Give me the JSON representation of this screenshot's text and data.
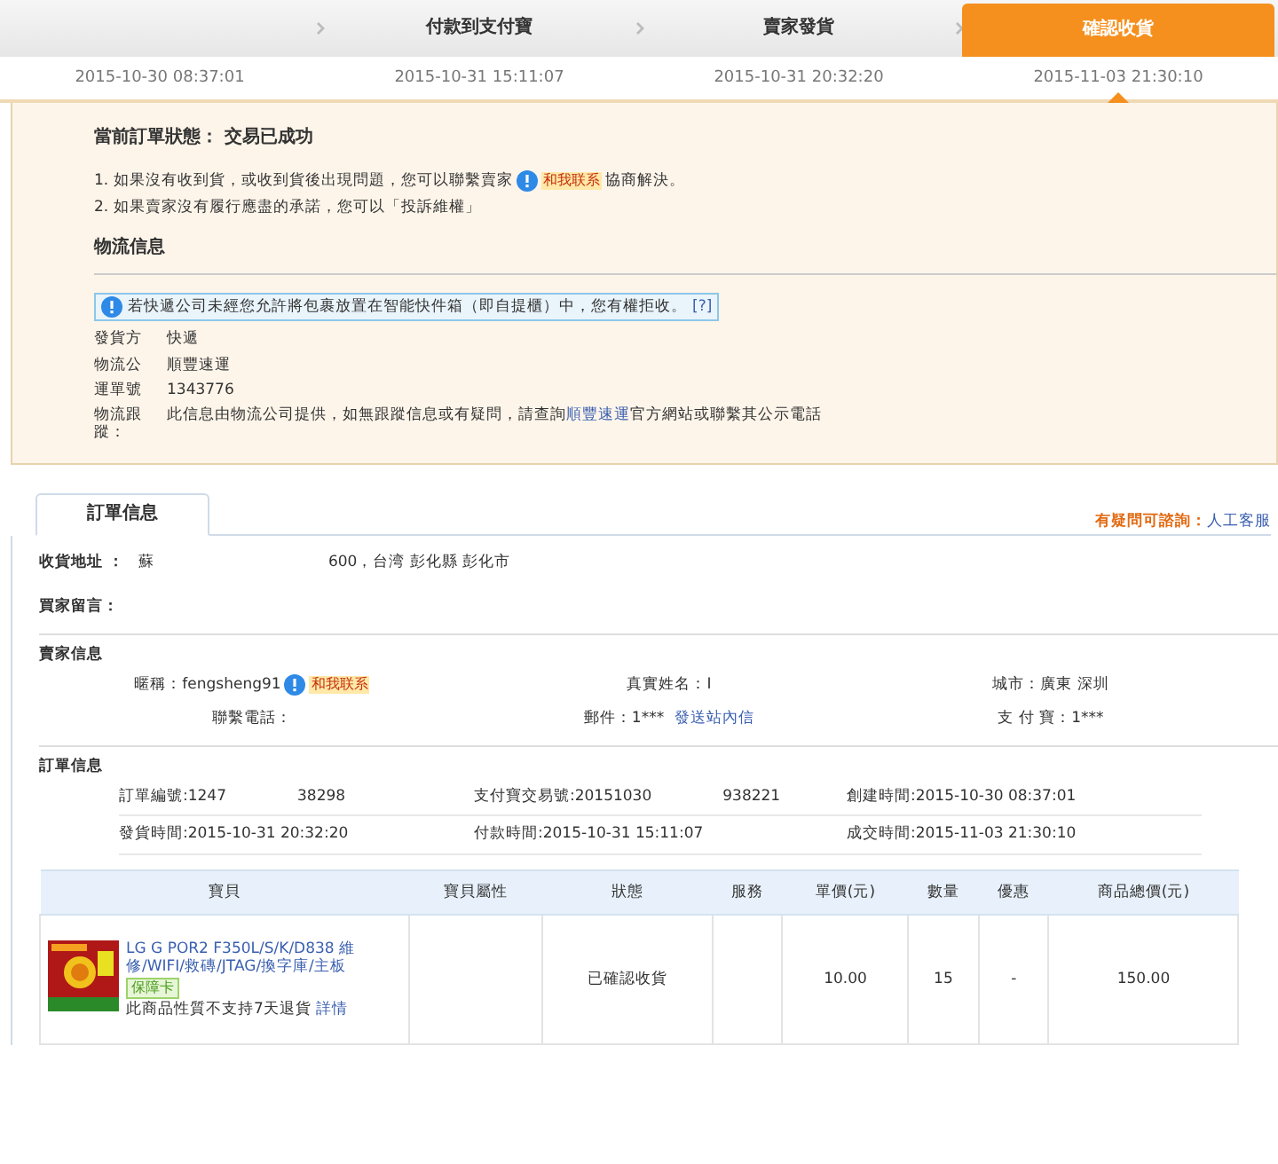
{
  "steps": [
    {
      "date": "2015-10-30 08:37:01",
      "selected": false
    },
    {
      "label": "付款到支付寶",
      "date": "2015-10-31 15:11:07",
      "selected": false
    },
    {
      "label": "賣家發貨",
      "date": "2015-10-31 20:32:20",
      "selected": false
    },
    {
      "label": "確認收貨",
      "date": "2015-11-03 21:30:10",
      "selected": true
    }
  ],
  "status": "當前訂單狀態： 交易已成功",
  "notes": [
    {
      "before": "1. 如果沒有收到貨，或收到貨後出現問題，您可以聯繫賣家",
      "badge": "和我联系",
      "after": "協商解決。"
    },
    {
      "before": "2. 如果賣家沒有履行應盡的承諾，您可以「投訴維權」"
    }
  ],
  "logistics": {
    "title": "物流信息",
    "notice": "若快遞公司未經您允許將包裹放置在智能快件箱（即自提櫃）中，您有權拒收。",
    "help": "[?]",
    "rows": [
      {
        "label": "發貨方",
        "value": "快遞"
      },
      {
        "label": "物流公",
        "value": "順豐速運"
      },
      {
        "label": "運單號",
        "value": "1343776"
      },
      {
        "label": "物流跟蹤：",
        "value": "此信息由物流公司提供，如無跟蹤信息或有疑問，請查詢",
        "link": "順豐速運",
        "after": "官方網站或聯繫其公示電話"
      }
    ]
  },
  "order": {
    "tab": "訂單信息",
    "help": "有疑問可諮詢：",
    "help_link": "人工客服",
    "address_label": "收貨地址 ：",
    "address_parts": [
      "蘇",
      "600，台湾 彭化縣 彭化市"
    ],
    "note_label": "買家留言：",
    "seller": {
      "title": "賣家信息",
      "fields": [
        {
          "text": "暱稱：fengsheng91",
          "badge": "和我联系"
        },
        {
          "text": "真實姓名：I"
        },
        {
          "text": "城市：廣東 深圳"
        },
        {
          "text": "聯繫電話："
        },
        {
          "text": "郵件：1***",
          "link": "發送站內信"
        },
        {
          "text": "支 付 寶：1***"
        }
      ]
    },
    "info": {
      "title": "訂單信息",
      "fields": [
        {
          "parts": [
            "訂單編號:1247",
            "38298"
          ]
        },
        {
          "parts": [
            "支付寶交易號:20151030",
            "938221"
          ]
        },
        {
          "parts": [
            "創建時間:2015-10-30 08:37:01"
          ]
        },
        {
          "parts": [
            "發貨時間:2015-10-31 20:32:20"
          ]
        },
        {
          "parts": [
            "付款時間:2015-10-31 15:11:07"
          ]
        },
        {
          "parts": [
            "成交時間:2015-11-03 21:30:10"
          ]
        }
      ]
    },
    "table": {
      "columns": [
        "寶貝",
        "寶貝屬性",
        "狀態",
        "服務",
        "單價(元)",
        "數量",
        "優惠",
        "商品總價(元)"
      ],
      "rows": [
        {
          "kind": "picture",
          "title": "LG G POR2 F350L/S/K/D838 維修/WIFI/救磚/JTAG/換字庫/主板",
          "tag": "保障卡",
          "policy": "此商品性質不支持7天退貨",
          "details": "詳情",
          "attrs": "",
          "status": "已確認收貨",
          "service": "",
          "price": "10.00",
          "qty": "15",
          "discount": "-",
          "total": "150.00"
        }
      ]
    }
  }
}
